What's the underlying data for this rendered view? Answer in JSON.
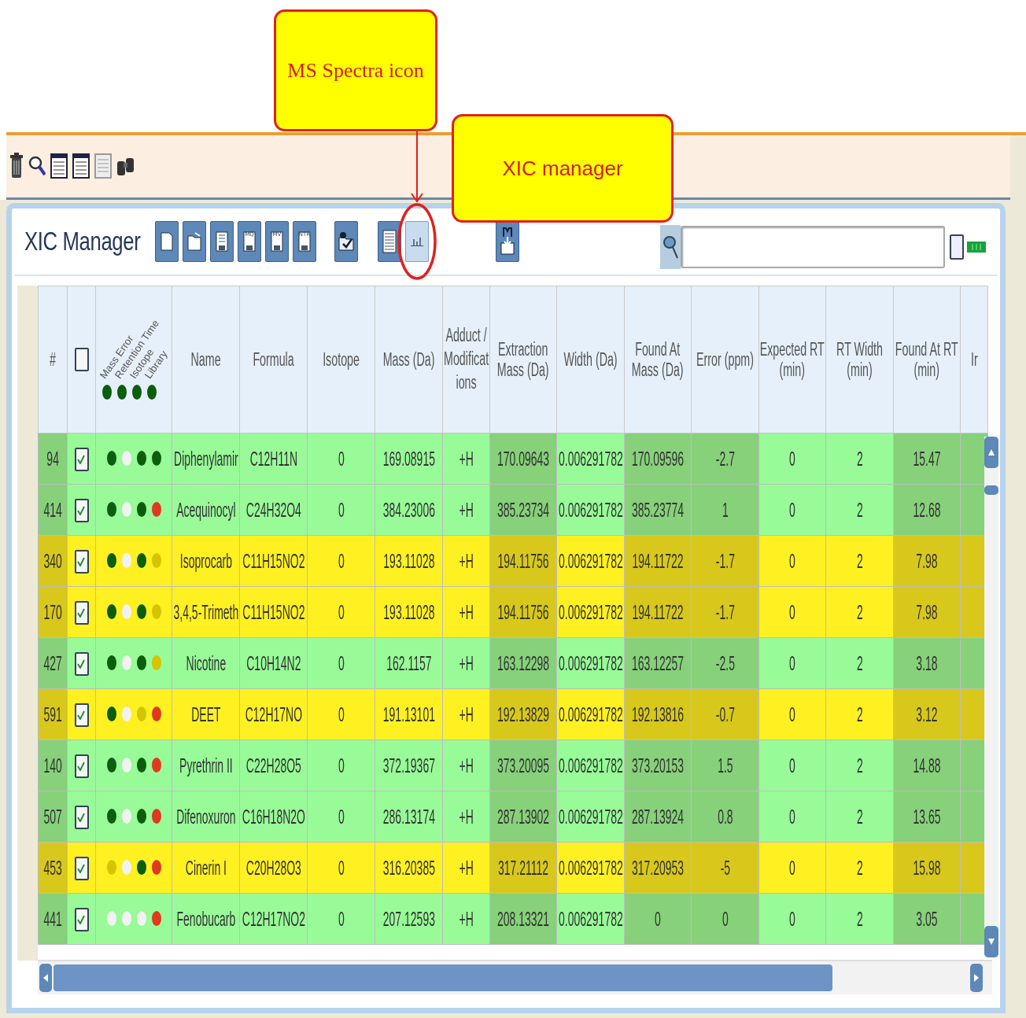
{
  "annotations": [
    {
      "text": "MS Spectra icon"
    },
    {
      "text": "XIC manager"
    }
  ],
  "xic_manager": {
    "title": "XIC Manager",
    "save_labels": [
      "MQ",
      "MV",
      "NTR"
    ],
    "ms_spectra_button": {
      "selected": true
    },
    "search_toggle": {
      "checked": false
    }
  },
  "table": {
    "header_checked": false,
    "indicator_labels": [
      "Mass Error",
      "Retention Time",
      "Isotope",
      "Library"
    ],
    "header_dots": [
      {
        "color": "#0b5e0b"
      },
      {
        "color": "#0b5e0b"
      },
      {
        "color": "#0b5e0b"
      },
      {
        "color": "#0b5e0b"
      }
    ],
    "columns": [
      {
        "label": "#",
        "shaded": true
      },
      {
        "label": "Name",
        "shaded": false
      },
      {
        "label": "Formula",
        "shaded": false
      },
      {
        "label": "Isotope",
        "shaded": false
      },
      {
        "label": "Mass (Da)",
        "shaded": false
      },
      {
        "label": "Adduct / Modifications",
        "shaded": false
      },
      {
        "label": "Extraction Mass (Da)",
        "shaded": true
      },
      {
        "label": "Width (Da)",
        "shaded": false
      },
      {
        "label": "Found At Mass (Da)",
        "shaded": true
      },
      {
        "label": "Error (ppm)",
        "shaded": true
      },
      {
        "label": "Expected RT (min)",
        "shaded": false
      },
      {
        "label": "RT Width (min)",
        "shaded": false
      },
      {
        "label": "Found At RT (min)",
        "shaded": true
      },
      {
        "label": "Ir",
        "shaded": true
      }
    ],
    "rows": [
      {
        "checked": true,
        "color": "#98fb98",
        "dots": [
          {
            "color": "#0b5e0b"
          },
          {
            "color": "#f2f2f2"
          },
          {
            "color": "#0b5e0b"
          },
          {
            "color": "#0b5e0b"
          }
        ],
        "cells": [
          "94",
          "Diphenylamir",
          "C12H11N",
          "0",
          "169.08915",
          "+H",
          "170.09643",
          "0.006291782",
          "170.09596",
          "-2.7",
          "0",
          "2",
          "15.47"
        ]
      },
      {
        "checked": true,
        "color": "#98fb98",
        "dots": [
          {
            "color": "#0b5e0b"
          },
          {
            "color": "#f2f2f2"
          },
          {
            "color": "#0b5e0b"
          },
          {
            "color": "#e03a1e"
          }
        ],
        "cells": [
          "414",
          "Acequinocyl",
          "C24H32O4",
          "0",
          "384.23006",
          "+H",
          "385.23734",
          "0.006291782",
          "385.23774",
          "1",
          "0",
          "2",
          "12.68"
        ]
      },
      {
        "checked": true,
        "color": "#fff022",
        "dots": [
          {
            "color": "#0b5e0b"
          },
          {
            "color": "#f2f2f2"
          },
          {
            "color": "#0b5e0b"
          },
          {
            "color": "#d6c400"
          }
        ],
        "cells": [
          "340",
          "Isoprocarb",
          "C11H15NO2",
          "0",
          "193.11028",
          "+H",
          "194.11756",
          "0.006291782",
          "194.11722",
          "-1.7",
          "0",
          "2",
          "7.98"
        ]
      },
      {
        "checked": true,
        "color": "#fff022",
        "dots": [
          {
            "color": "#0b5e0b"
          },
          {
            "color": "#f2f2f2"
          },
          {
            "color": "#0b5e0b"
          },
          {
            "color": "#d6c400"
          }
        ],
        "cells": [
          "170",
          "3,4,5-Trimeth",
          "C11H15NO2",
          "0",
          "193.11028",
          "+H",
          "194.11756",
          "0.006291782",
          "194.11722",
          "-1.7",
          "0",
          "2",
          "7.98"
        ]
      },
      {
        "checked": true,
        "color": "#98fb98",
        "dots": [
          {
            "color": "#0b5e0b"
          },
          {
            "color": "#f2f2f2"
          },
          {
            "color": "#0b5e0b"
          },
          {
            "color": "#d6c400"
          }
        ],
        "cells": [
          "427",
          "Nicotine",
          "C10H14N2",
          "0",
          "162.1157",
          "+H",
          "163.12298",
          "0.006291782",
          "163.12257",
          "-2.5",
          "0",
          "2",
          "3.18"
        ]
      },
      {
        "checked": true,
        "color": "#fff022",
        "dots": [
          {
            "color": "#0b5e0b"
          },
          {
            "color": "#f2f2f2"
          },
          {
            "color": "#d6c400"
          },
          {
            "color": "#e03a1e"
          }
        ],
        "cells": [
          "591",
          "DEET",
          "C12H17NO",
          "0",
          "191.13101",
          "+H",
          "192.13829",
          "0.006291782",
          "192.13816",
          "-0.7",
          "0",
          "2",
          "3.12"
        ]
      },
      {
        "checked": true,
        "color": "#98fb98",
        "dots": [
          {
            "color": "#0b5e0b"
          },
          {
            "color": "#f2f2f2"
          },
          {
            "color": "#0b5e0b"
          },
          {
            "color": "#e03a1e"
          }
        ],
        "cells": [
          "140",
          "Pyrethrin II",
          "C22H28O5",
          "0",
          "372.19367",
          "+H",
          "373.20095",
          "0.006291782",
          "373.20153",
          "1.5",
          "0",
          "2",
          "14.88"
        ]
      },
      {
        "checked": true,
        "color": "#98fb98",
        "dots": [
          {
            "color": "#0b5e0b"
          },
          {
            "color": "#f2f2f2"
          },
          {
            "color": "#0b5e0b"
          },
          {
            "color": "#e03a1e"
          }
        ],
        "cells": [
          "507",
          "Difenoxuron",
          "C16H18N2O",
          "0",
          "286.13174",
          "+H",
          "287.13902",
          "0.006291782",
          "287.13924",
          "0.8",
          "0",
          "2",
          "13.65"
        ]
      },
      {
        "checked": true,
        "color": "#fff022",
        "dots": [
          {
            "color": "#d6c400"
          },
          {
            "color": "#f2f2f2"
          },
          {
            "color": "#0b5e0b"
          },
          {
            "color": "#e03a1e"
          }
        ],
        "cells": [
          "453",
          "Cinerin I",
          "C20H28O3",
          "0",
          "316.20385",
          "+H",
          "317.21112",
          "0.006291782",
          "317.20953",
          "-5",
          "0",
          "2",
          "15.98"
        ]
      },
      {
        "checked": true,
        "color": "#98fb98",
        "dots": [
          {
            "color": "#f2f2f2"
          },
          {
            "color": "#f2f2f2"
          },
          {
            "color": "#f2f2f2"
          },
          {
            "color": "#e03a1e"
          }
        ],
        "cells": [
          "441",
          "Fenobucarb",
          "C12H17NO2",
          "0",
          "207.12593",
          "+H",
          "208.13321",
          "0.006291782",
          "0",
          "0",
          "0",
          "2",
          "3.05"
        ]
      }
    ]
  }
}
